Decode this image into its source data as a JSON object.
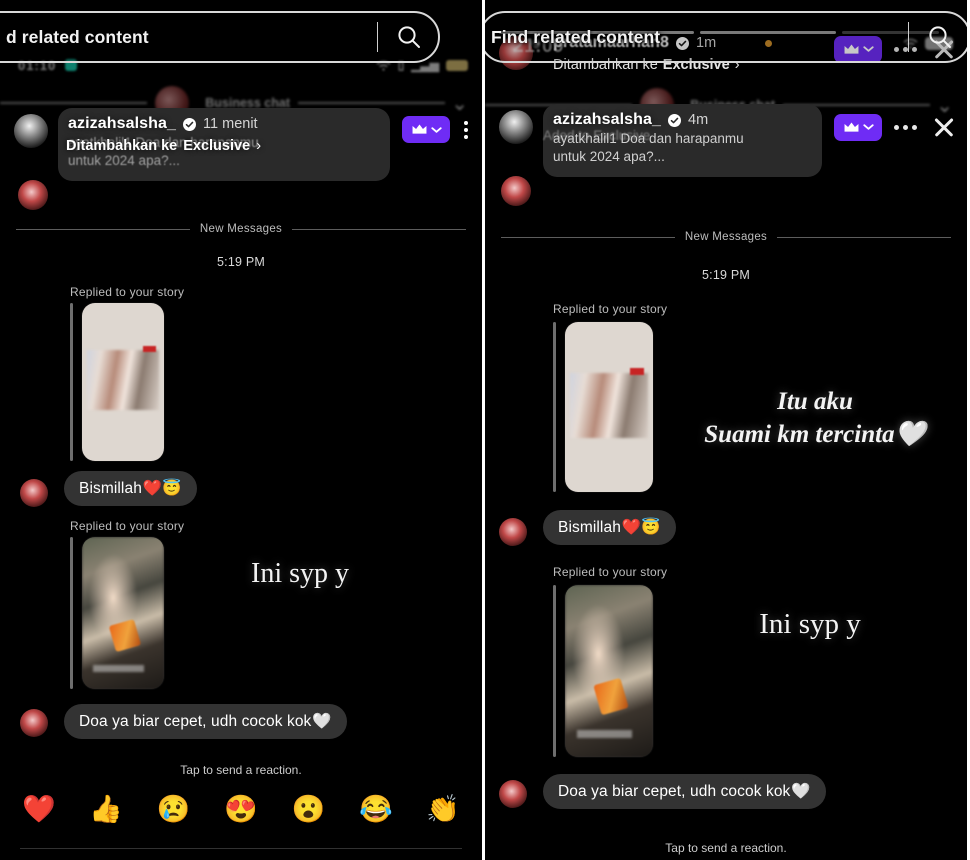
{
  "overlay": {
    "left_search_text": "d related content",
    "right_search_text": "Find related content",
    "search_icon": "search-icon"
  },
  "left_panel": {
    "status_bar": {
      "time": "01:10",
      "icons": [
        "wifi-icon",
        "signal-icon",
        "battery-icon"
      ]
    },
    "ghost_row": {
      "label": "Business chat",
      "chevron": "chevron-down-icon"
    },
    "notification": {
      "username": "azizahsalsha_",
      "verified": true,
      "time": "11 menit",
      "body_ghost_line1": "ayatkhalil1 Doa dan harapanmu",
      "body_ghost_line2": "untuk 2024 apa?...",
      "badge": "crown-icon",
      "badge_chevron": "chevron-down-icon",
      "menu": "kebab-menu-icon"
    },
    "exclusive_overlay": {
      "text": "Ditambahkan ke ",
      "bold": "Exclusive",
      "chevron": "›"
    },
    "divider_label": "New Messages",
    "timestamp": "5:19 PM",
    "messages": [
      {
        "reply_label": "Replied to your story",
        "bubble_text": "Bismillah",
        "bubble_emojis": "❤️😇"
      },
      {
        "reply_label": "Replied to your story",
        "script_text": "Ini syp y",
        "bubble_text": "Doa ya biar cepet, udh cocok kok",
        "bubble_emojis": "🤍"
      }
    ],
    "reaction_hint": "Tap to send a reaction.",
    "reactions": [
      "❤️",
      "👍",
      "😢",
      "😍",
      "😮",
      "😂",
      "👏"
    ]
  },
  "right_panel": {
    "status_bar": {
      "time": "21:09",
      "icons": [
        "wifi-icon",
        "battery-icon"
      ]
    },
    "notifications": [
      {
        "username": "pratamaarhan8",
        "verified": true,
        "time": "1m",
        "subtitle_prefix": "Ditambahkan ke ",
        "subtitle_bold": "Exclusive",
        "subtitle_chevron": "›",
        "badge": "crown-icon",
        "badge_chevron": "chevron-down-icon",
        "menu": "dots-menu-icon",
        "close": "close-icon"
      },
      {
        "username": "azizahsalsha_",
        "verified": true,
        "time": "4m",
        "body_line1": "ayatkhalil1 Doa dan harapanmu",
        "body_line2": "untuk 2024 apa?...",
        "ghost_line": "Aded to Exclusive",
        "badge": "crown-icon",
        "badge_chevron": "chevron-down-icon",
        "menu": "dots-menu-icon",
        "close": "close-icon"
      }
    ],
    "ghost_row": {
      "label": "Business chat",
      "chevron": "chevron-down-icon"
    },
    "divider_label": "New Messages",
    "timestamp": "5:19 PM",
    "messages": [
      {
        "reply_label": "Replied to your story",
        "script_line1": "Itu aku",
        "script_line2": "Suami km tercinta",
        "script_emoji": "🤍",
        "bubble_text": "Bismillah",
        "bubble_emojis": "❤️😇"
      },
      {
        "reply_label": "Replied to your story",
        "script_text": "Ini syp y",
        "bubble_text": "Doa ya biar cepet, udh cocok kok",
        "bubble_emojis": "🤍"
      }
    ],
    "reaction_hint": "Tap to send a reaction."
  },
  "colors": {
    "background": "#000000",
    "accent_purple": "#6f2cf5",
    "bubble": "#333333",
    "card": "#2a2a2a",
    "verified_blue": "#ffffff"
  }
}
